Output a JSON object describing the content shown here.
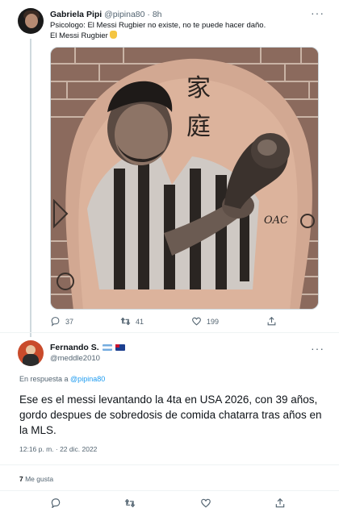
{
  "tweet1": {
    "display_name": "Gabriela Pipi",
    "handle": "@pipina80",
    "separator": "·",
    "age": "8h",
    "more": "···",
    "text_line1": "Psicologo: El Messi Rugbier no existe, no te puede hacer daño.",
    "text_line2": "El Messi Rugbier",
    "media": {
      "tattoo_characters": [
        "家",
        "庭"
      ],
      "tattoo_initials": "OAC"
    },
    "stats": {
      "replies": "37",
      "retweets": "41",
      "likes": "199"
    }
  },
  "tweet2": {
    "display_name": "Fernando S.",
    "handle": "@meddle2010",
    "more": "···",
    "reply_prefix": "En respuesta a ",
    "reply_handle": "@pipina80",
    "text": "Ese es el messi levantando la 4ta en USA 2026, con 39 años, gordo despues de sobredosis de comida chatarra tras años en la MLS.",
    "timestamp": "12:16 p. m. · 22 dic. 2022",
    "likes_count": "7",
    "likes_label": " Me gusta"
  },
  "colors": {
    "accent": "#1d9bf0",
    "secondary_text": "#536471",
    "divider": "#eff3f4"
  },
  "icons": [
    "reply-icon",
    "retweet-icon",
    "like-icon",
    "share-icon",
    "more-icon"
  ]
}
